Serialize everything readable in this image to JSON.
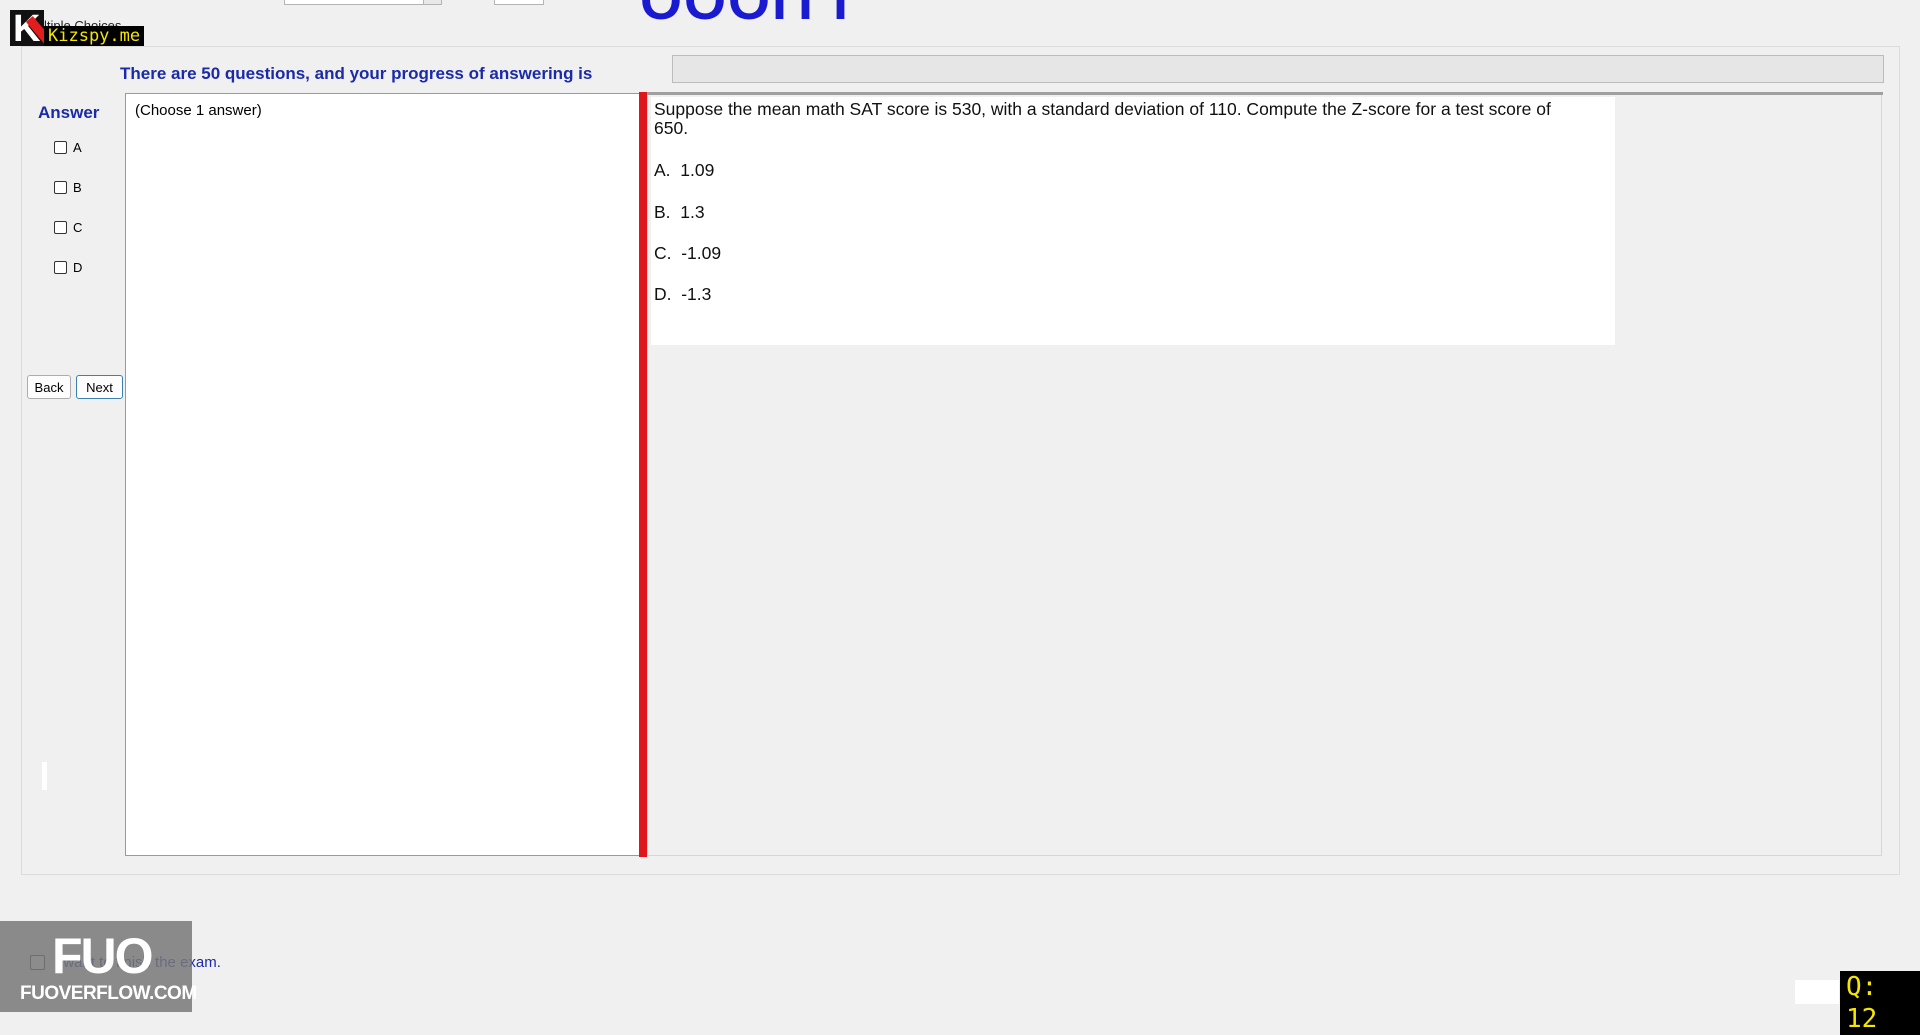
{
  "header": {
    "partial_title": "OOOITT",
    "mode_label": "ltiple Choices"
  },
  "watermark": {
    "top_logo_text": "Kizspy.me",
    "bottom_logo_big": "FUO",
    "bottom_logo_small": "FUOVERFLOW.COM",
    "question_badge": "Q: 12"
  },
  "progress": {
    "label": "There are 50 questions, and your progress of answering is",
    "value_percent": 0
  },
  "answer_panel": {
    "title": "Answer",
    "options": [
      "A",
      "B",
      "C",
      "D"
    ],
    "back_label": "Back",
    "next_label": "Next"
  },
  "choose_panel": {
    "instruction": "(Choose 1 answer)"
  },
  "question": {
    "text": "Suppose the mean math SAT score is 530, with a standard deviation of 110. Compute the Z-score for a test score of 650.",
    "options": [
      "A.  1.09",
      "B.  1.3",
      "C.  -1.09",
      "D.  -1.3"
    ]
  },
  "footer": {
    "finish_label": "I want to finish the exam."
  }
}
